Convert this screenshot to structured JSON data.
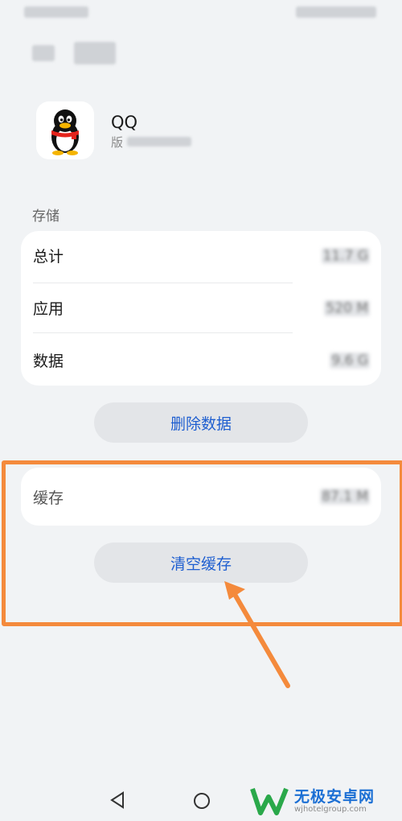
{
  "app": {
    "name": "QQ",
    "version_prefix": "版"
  },
  "storage": {
    "section_label": "存储",
    "rows": [
      {
        "label": "总计",
        "value": "11.7 G"
      },
      {
        "label": "应用",
        "value": "520 M"
      },
      {
        "label": "数据",
        "value": "9.6 G"
      }
    ],
    "delete_button_label": "删除数据"
  },
  "cache": {
    "label": "缓存",
    "value": "87.1 M",
    "clear_button_label": "清空缓存"
  },
  "watermark": {
    "title": "无极安卓网",
    "url": "wjhotelgroup.com"
  },
  "colors": {
    "accent": "#1f5fd0",
    "highlight": "#f48a3c",
    "background": "#f1f3f5"
  }
}
